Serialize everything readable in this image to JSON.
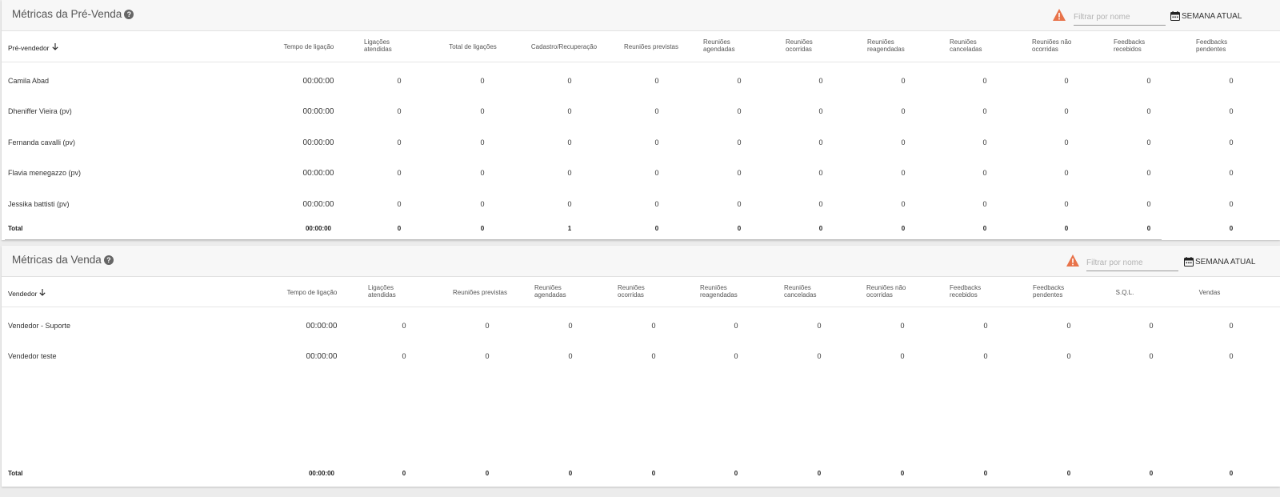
{
  "pre": {
    "title": "Métricas da Pré-Venda",
    "filter_placeholder": "Filtrar por nome",
    "week_label": "SEMANA ATUAL",
    "name_header": "Pré-vendedor",
    "columns": [
      [
        "Tempo de ligação"
      ],
      [
        "Ligações",
        "atendidas"
      ],
      [
        "Total de ligações"
      ],
      [
        "Cadastro/Recuperação"
      ],
      [
        "Reuniões previstas"
      ],
      [
        "Reuniões",
        "agendadas"
      ],
      [
        "Reuniões",
        "ocorridas"
      ],
      [
        "Reuniões",
        "reagendadas"
      ],
      [
        "Reuniões",
        "canceladas"
      ],
      [
        "Reuniões não",
        "ocorridas"
      ],
      [
        "Feedbacks",
        "recebidos"
      ],
      [
        "Feedbacks",
        "pendentes"
      ]
    ],
    "rows": [
      {
        "name": "Camila Abad",
        "values": [
          "00:00:00",
          "0",
          "0",
          "0",
          "0",
          "0",
          "0",
          "0",
          "0",
          "0",
          "0",
          "0"
        ]
      },
      {
        "name": "Dheniffer Vieira (pv)",
        "values": [
          "00:00:00",
          "0",
          "0",
          "0",
          "0",
          "0",
          "0",
          "0",
          "0",
          "0",
          "0",
          "0"
        ]
      },
      {
        "name": "Fernanda cavalli (pv)",
        "values": [
          "00:00:00",
          "0",
          "0",
          "0",
          "0",
          "0",
          "0",
          "0",
          "0",
          "0",
          "0",
          "0"
        ]
      },
      {
        "name": "Flavia menegazzo (pv)",
        "values": [
          "00:00:00",
          "0",
          "0",
          "0",
          "0",
          "0",
          "0",
          "0",
          "0",
          "0",
          "0",
          "0"
        ]
      },
      {
        "name": "Jessika battisti (pv)",
        "values": [
          "00:00:00",
          "0",
          "0",
          "0",
          "0",
          "0",
          "0",
          "0",
          "0",
          "0",
          "0",
          "0"
        ]
      }
    ],
    "total": {
      "name": "Total",
      "values": [
        "00:00:00",
        "0",
        "0",
        "1",
        "0",
        "0",
        "0",
        "0",
        "0",
        "0",
        "0",
        "0"
      ]
    }
  },
  "venda": {
    "title": "Métricas da Venda",
    "filter_placeholder": "Filtrar por nome",
    "week_label": "SEMANA ATUAL",
    "name_header": "Vendedor",
    "columns": [
      [
        "Tempo de ligação"
      ],
      [
        "Ligações",
        "atendidas"
      ],
      [
        "Reuniões previstas"
      ],
      [
        "Reuniões",
        "agendadas"
      ],
      [
        "Reuniões",
        "ocorridas"
      ],
      [
        "Reuniões",
        "reagendadas"
      ],
      [
        "Reuniões",
        "canceladas"
      ],
      [
        "Reuniões não",
        "ocorridas"
      ],
      [
        "Feedbacks",
        "recebidos"
      ],
      [
        "Feedbacks",
        "pendentes"
      ],
      [
        "S.Q.L."
      ],
      [
        "Vendas"
      ]
    ],
    "rows": [
      {
        "name": "Vendedor - Suporte",
        "values": [
          "00:00:00",
          "0",
          "0",
          "0",
          "0",
          "0",
          "0",
          "0",
          "0",
          "0",
          "0",
          "0"
        ]
      },
      {
        "name": "Vendedor teste",
        "values": [
          "00:00:00",
          "0",
          "0",
          "0",
          "0",
          "0",
          "0",
          "0",
          "0",
          "0",
          "0",
          "0"
        ]
      }
    ],
    "total": {
      "name": "Total",
      "values": [
        "00:00:00",
        "0",
        "0",
        "0",
        "0",
        "0",
        "0",
        "0",
        "0",
        "0",
        "0",
        "0"
      ]
    }
  },
  "colors": {
    "warning": "#e8734a",
    "header_bg": "#f7f7f7"
  }
}
